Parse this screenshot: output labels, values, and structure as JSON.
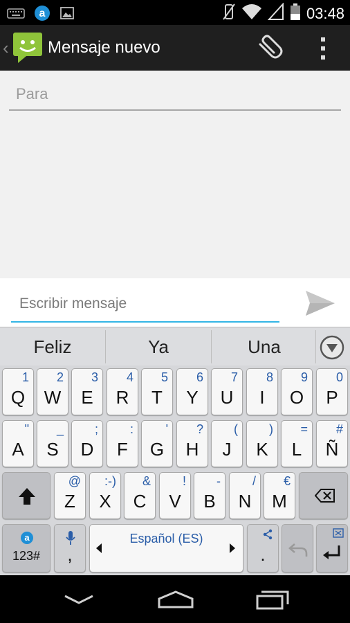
{
  "status_bar": {
    "left_icons": [
      "keyboard-icon",
      "app-a-icon",
      "image-icon"
    ],
    "right_icons": [
      "vibrate-icon",
      "wifi-icon",
      "signal-icon",
      "battery-icon"
    ],
    "time": "03:48"
  },
  "action_bar": {
    "title": "Mensaje nuevo",
    "icons": [
      "back-chevron-icon",
      "messaging-app-icon",
      "attach-icon",
      "overflow-menu-icon"
    ]
  },
  "compose": {
    "to_placeholder": "Para",
    "message_placeholder": "Escribir mensaje"
  },
  "suggestions": {
    "items": [
      "Feliz",
      "Ya",
      "Una"
    ]
  },
  "keyboard": {
    "rows": [
      [
        {
          "main": "Q",
          "alt": "1"
        },
        {
          "main": "W",
          "alt": "2"
        },
        {
          "main": "E",
          "alt": "3"
        },
        {
          "main": "R",
          "alt": "4"
        },
        {
          "main": "T",
          "alt": "5"
        },
        {
          "main": "Y",
          "alt": "6"
        },
        {
          "main": "U",
          "alt": "7"
        },
        {
          "main": "I",
          "alt": "8"
        },
        {
          "main": "O",
          "alt": "9"
        },
        {
          "main": "P",
          "alt": "0"
        }
      ],
      [
        {
          "main": "A",
          "alt": "\""
        },
        {
          "main": "S",
          "alt": "_"
        },
        {
          "main": "D",
          "alt": ";"
        },
        {
          "main": "F",
          "alt": ":"
        },
        {
          "main": "G",
          "alt": "'"
        },
        {
          "main": "H",
          "alt": "?"
        },
        {
          "main": "J",
          "alt": "("
        },
        {
          "main": "K",
          "alt": ")"
        },
        {
          "main": "L",
          "alt": "="
        },
        {
          "main": "Ñ",
          "alt": "#"
        }
      ],
      [
        {
          "main": "Z",
          "alt": "@"
        },
        {
          "main": "X",
          "alt": ":-)"
        },
        {
          "main": "C",
          "alt": "&"
        },
        {
          "main": "V",
          "alt": "!"
        },
        {
          "main": "B",
          "alt": "-"
        },
        {
          "main": "N",
          "alt": "/"
        },
        {
          "main": "M",
          "alt": "€"
        }
      ]
    ],
    "numbers_label": "123#",
    "comma_label": ",",
    "period_label": ".",
    "space_label": "Español (ES)"
  },
  "colors": {
    "accent": "#33b5e5",
    "alt_key_text": "#2a5da8",
    "app_icon_green": "#8fc43a"
  }
}
